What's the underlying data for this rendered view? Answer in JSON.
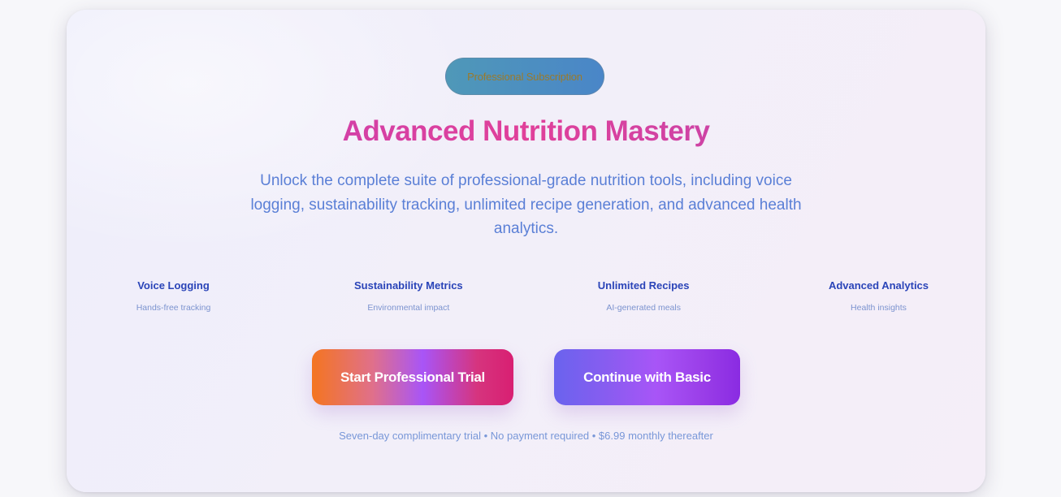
{
  "badge": {
    "label": "Professional Subscription"
  },
  "hero": {
    "title": "Advanced Nutrition Mastery",
    "subtitle": "Unlock the complete suite of professional-grade nutrition tools, including voice logging, sustainability tracking, unlimited recipe generation, and advanced health analytics."
  },
  "features": [
    {
      "title": "Voice Logging",
      "description": "Hands-free tracking"
    },
    {
      "title": "Sustainability Metrics",
      "description": "Environmental impact"
    },
    {
      "title": "Unlimited Recipes",
      "description": "AI-generated meals"
    },
    {
      "title": "Advanced Analytics",
      "description": "Health insights"
    }
  ],
  "actions": {
    "primary_label": "Start Professional Trial",
    "secondary_label": "Continue with Basic"
  },
  "footnote": "Seven-day complimentary trial • No payment required • $6.99 monthly thereafter",
  "colors": {
    "title_gradient_start": "#c040b8",
    "title_gradient_mid": "#e0409a",
    "subtitle": "#5a7fd6",
    "feature_title": "#2a44b8",
    "primary_button_start": "#f47520",
    "primary_button_end": "#d81f72",
    "secondary_button_start": "#6a63ee",
    "secondary_button_end": "#8a2be2"
  }
}
